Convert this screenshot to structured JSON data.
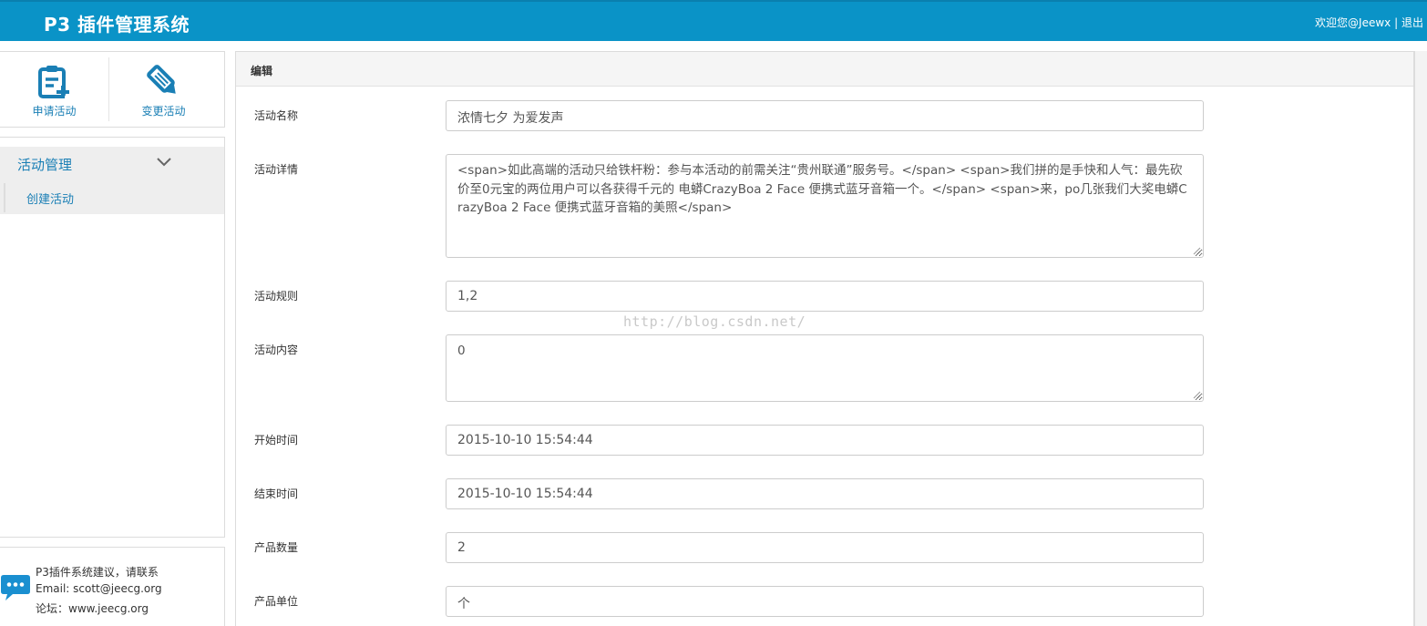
{
  "header": {
    "title": "P3 插件管理系统",
    "welcome": "欢迎您@Jeewx",
    "separator": "|",
    "logout": "退出"
  },
  "shortcuts": [
    {
      "label": "申请活动",
      "icon": "clipboard-plus-icon"
    },
    {
      "label": "变更活动",
      "icon": "pencil-icon"
    }
  ],
  "sidebar": {
    "group_title": "活动管理",
    "items": [
      {
        "label": "创建活动"
      }
    ]
  },
  "contact": {
    "line1": "P3插件系统建议，请联系",
    "line2": "Email: scott@jeecg.org",
    "line3": "论坛：www.jeecg.org"
  },
  "panel": {
    "title": "编辑"
  },
  "form": {
    "name_label": "活动名称",
    "name_value": "浓情七夕 为爱发声",
    "detail_label": "活动详情",
    "detail_value": "<span>如此高端的活动只给铁杆粉：参与本活动的前需关注“贵州联通”服务号。</span> <span>我们拼的是手快和人气：最先砍价至0元宝的两位用户可以各获得千元的 电蟒CrazyBoa 2 Face 便携式蓝牙音箱一个。</span> <span>来，po几张我们大奖电蟒CrazyBoa 2 Face 便携式蓝牙音箱的美照</span>",
    "rule_label": "活动规则",
    "rule_value": "1,2",
    "content_label": "活动内容",
    "content_value": "0",
    "start_label": "开始时间",
    "start_value": "2015-10-10 15:54:44",
    "end_label": "结束时间",
    "end_value": "2015-10-10 15:54:44",
    "qty_label": "产品数量",
    "qty_value": "2",
    "unit_label": "产品单位",
    "unit_value": "个"
  },
  "watermark": "http://blog.csdn.net/",
  "colors": {
    "header_bg": "#0a93c7",
    "accent": "#1a7fb5"
  }
}
